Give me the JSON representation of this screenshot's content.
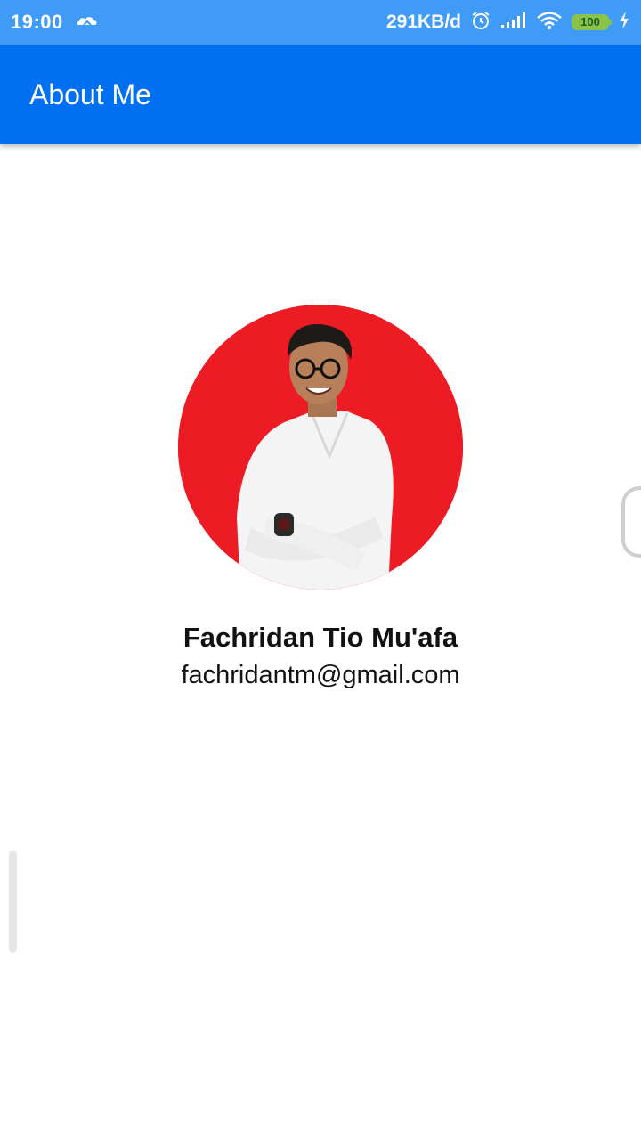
{
  "status_bar": {
    "time": "19:00",
    "network_speed": "291KB/d",
    "battery_level": "100",
    "icons": [
      "cloud-app-icon",
      "alarm-icon",
      "signal-icon",
      "wifi-icon",
      "battery-icon",
      "charging-icon"
    ]
  },
  "app_bar": {
    "title": "About Me"
  },
  "profile": {
    "name": "Fachridan Tio Mu'afa",
    "email": "fachridantm@gmail.com",
    "avatar_background": "#ed1c24"
  },
  "colors": {
    "status_bar": "#3f9bf5",
    "app_bar": "#006ff0",
    "battery": "#8bc34a"
  }
}
